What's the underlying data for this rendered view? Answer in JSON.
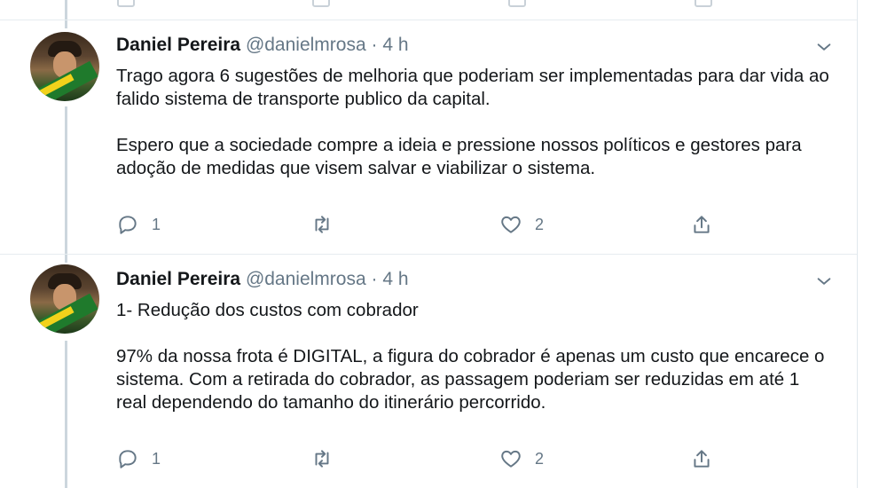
{
  "tweets": [
    {
      "author": "Daniel Pereira",
      "handle": "@danielmrosa",
      "separator": "·",
      "time": "4 h",
      "paragraphs": [
        "Trago agora 6 sugestões de melhoria que poderiam ser implementadas para dar vida ao falido sistema de transporte publico da capital.",
        "Espero que a sociedade compre a ideia e pressione nossos políticos e gestores para adoção de medidas que visem salvar e viabilizar o sistema."
      ],
      "reply_count": "1",
      "retweet_count": "",
      "like_count": "2"
    },
    {
      "author": "Daniel Pereira",
      "handle": "@danielmrosa",
      "separator": "·",
      "time": "4 h",
      "paragraphs": [
        "1- Redução dos custos com cobrador",
        "97% da nossa frota é DIGITAL, a figura do cobrador é apenas um custo que encarece o sistema. Com a retirada do cobrador, as passagem poderiam ser reduzidas em até 1 real dependendo do tamanho do itinerário percorrido."
      ],
      "reply_count": "1",
      "retweet_count": "",
      "like_count": "2"
    }
  ],
  "icons": {
    "reply": "reply-icon",
    "retweet": "retweet-icon",
    "like": "heart-icon",
    "share": "share-icon",
    "menu": "chevron-down-icon"
  },
  "colors": {
    "text": "#14171a",
    "muted": "#657786",
    "thread_line": "#ccd6dd",
    "divider": "#e6ecf0"
  }
}
